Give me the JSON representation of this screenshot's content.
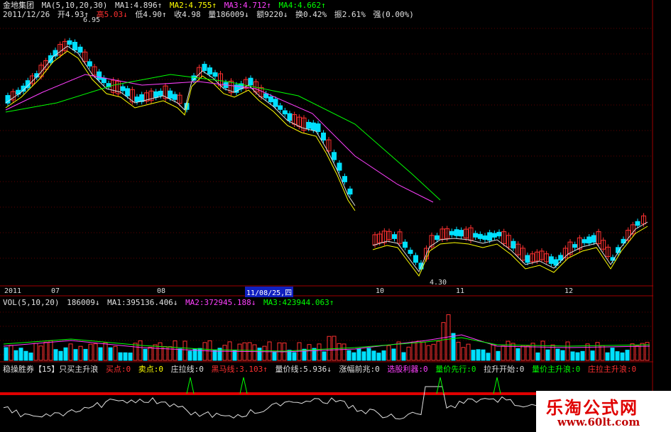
{
  "header": {
    "stock_name": "金地集团",
    "ma_params": "MA(5,10,20,30)",
    "ma1": "MA1:4.896↑",
    "ma2": "MA2:4.755↑",
    "ma3": "MA3:4.712↑",
    "ma4": "MA4:4.662↑",
    "date": "2011/12/26",
    "open": "开4.93↑",
    "high": "高5.03↓",
    "low": "低4.90↑",
    "close": "收4.98",
    "volume": "量186009↓",
    "amount": "额9220↓",
    "turnover": "换0.42%",
    "amplitude": "振2.61%",
    "strength": "强(0.00%)"
  },
  "annotations": {
    "high_marker": "6.95",
    "low_marker": "4.30"
  },
  "x_axis": {
    "labels": [
      "2011",
      "07",
      "08",
      "10",
      "11",
      "12"
    ],
    "cursor_date": "11/08/25,四"
  },
  "volume_header": {
    "params": "VOL(5,10,20)",
    "value": "186009↓",
    "ma1": "MA1:395136.406↓",
    "ma2": "MA2:372945.188↓",
    "ma3": "MA3:423944.063↑"
  },
  "indicator_header": {
    "name": "稳操胜券【15】只买主升浪",
    "buy": "买点:0",
    "sell": "卖点:0",
    "pull": "庄拉线:0",
    "dark_horse": "黑马线:3.103↑",
    "vol_price": "量价线:5.936↓",
    "rise_sign": "涨幅前兆:0",
    "stock_pick": "选股利器:0",
    "vp_lead": "量价先行:0",
    "pull_start": "拉升开始:0",
    "vp_main": "量价主升浪:0",
    "main_wave": "庄拉主升浪:0"
  },
  "watermark": {
    "title": "乐淘公式网",
    "url": "www.60lt.com"
  },
  "colors": {
    "up": "#ff3030",
    "down": "#00e0ff",
    "ma1": "#e0e0e0",
    "ma2": "#ffff00",
    "ma3": "#ff40ff",
    "ma4": "#00ff00",
    "signal_line": "#e00000"
  }
}
